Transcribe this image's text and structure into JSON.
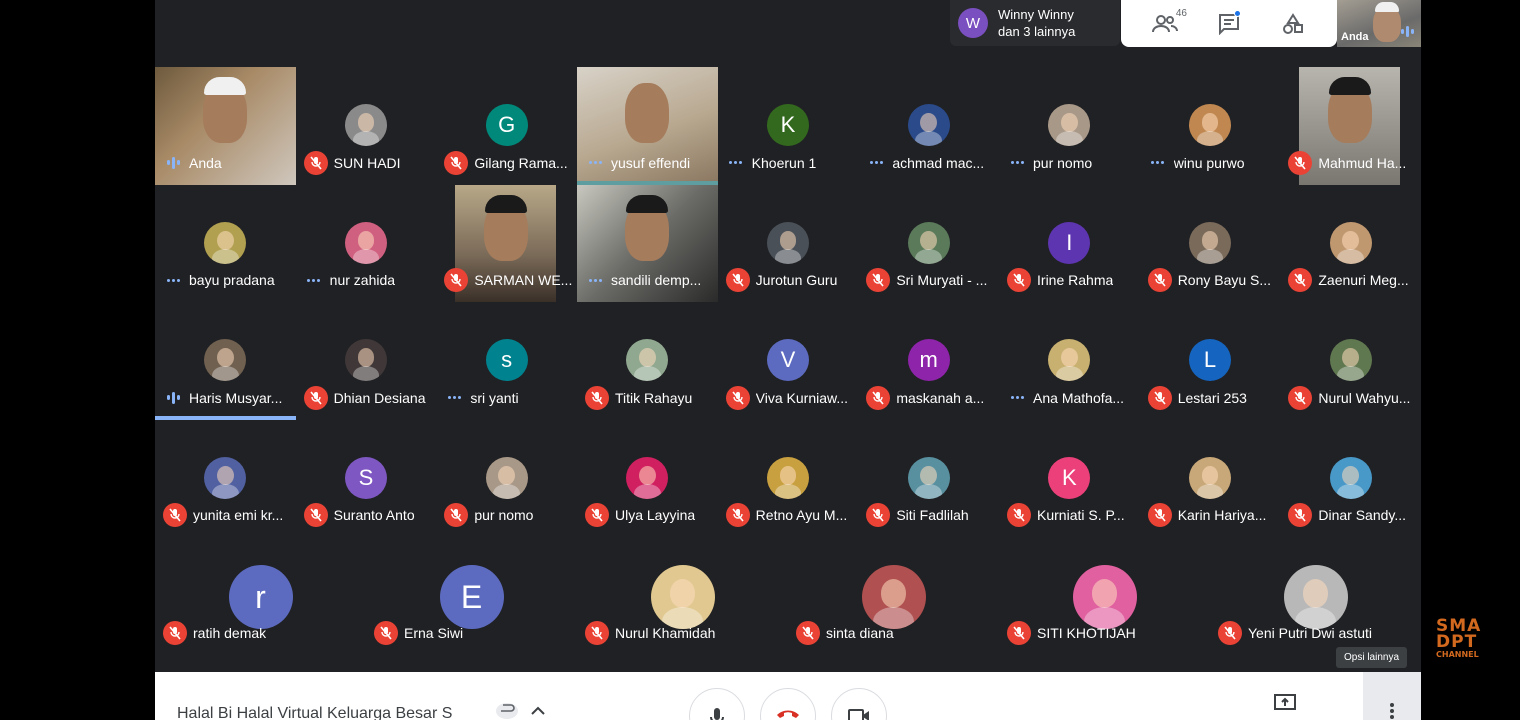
{
  "notification": {
    "avatar_letter": "W",
    "line1": "Winny Winny",
    "line2": "dan 3 lainnya"
  },
  "top_controls": {
    "participants_count": "46"
  },
  "self_view": {
    "label": "Anda"
  },
  "participants": [
    {
      "name": "Anda",
      "status": "speaking",
      "avatar": {
        "type": "video"
      }
    },
    {
      "name": "SUN HADI",
      "status": "muted",
      "avatar": {
        "type": "photo",
        "color": "#8a8a8a"
      }
    },
    {
      "name": "Gilang Rama...",
      "status": "muted",
      "avatar": {
        "type": "letter",
        "letter": "G",
        "color": "#00897b"
      }
    },
    {
      "name": "yusuf effendi",
      "status": "idle",
      "avatar": {
        "type": "video"
      }
    },
    {
      "name": "Khoerun 1",
      "status": "idle",
      "avatar": {
        "type": "letter",
        "letter": "K",
        "color": "#33691e"
      }
    },
    {
      "name": "achmad mac...",
      "status": "idle",
      "avatar": {
        "type": "photo",
        "color": "#2a4a8a"
      }
    },
    {
      "name": "pur nomo",
      "status": "idle",
      "avatar": {
        "type": "photo",
        "color": "#a89888"
      }
    },
    {
      "name": "winu purwo",
      "status": "idle",
      "avatar": {
        "type": "photo",
        "color": "#c08850"
      }
    },
    {
      "name": "Mahmud Ha...",
      "status": "muted",
      "avatar": {
        "type": "video"
      }
    },
    {
      "name": "bayu pradana",
      "status": "idle",
      "avatar": {
        "type": "photo",
        "color": "#b0a050"
      }
    },
    {
      "name": "nur zahida",
      "status": "idle",
      "avatar": {
        "type": "photo",
        "color": "#d06080"
      }
    },
    {
      "name": "SARMAN WE...",
      "status": "muted",
      "avatar": {
        "type": "video"
      }
    },
    {
      "name": "sandili demp...",
      "status": "idle",
      "avatar": {
        "type": "video"
      }
    },
    {
      "name": "Jurotun Guru",
      "status": "muted",
      "avatar": {
        "type": "photo",
        "color": "#4a5058"
      }
    },
    {
      "name": "Sri Muryati - ...",
      "status": "muted",
      "avatar": {
        "type": "photo",
        "color": "#5a7a5a"
      }
    },
    {
      "name": "Irine Rahma",
      "status": "muted",
      "avatar": {
        "type": "letter",
        "letter": "I",
        "color": "#5e35b1"
      }
    },
    {
      "name": "Rony Bayu S...",
      "status": "muted",
      "avatar": {
        "type": "photo",
        "color": "#7a6a5a"
      }
    },
    {
      "name": "Zaenuri Meg...",
      "status": "muted",
      "avatar": {
        "type": "photo",
        "color": "#c09870"
      }
    },
    {
      "name": "Haris Musyar...",
      "status": "speaking",
      "avatar": {
        "type": "photo",
        "color": "#706050"
      }
    },
    {
      "name": "Dhian Desiana",
      "status": "muted",
      "avatar": {
        "type": "photo",
        "color": "#403838"
      }
    },
    {
      "name": "sri yanti",
      "status": "idle",
      "avatar": {
        "type": "letter",
        "letter": "s",
        "color": "#00838f"
      }
    },
    {
      "name": "Titik Rahayu",
      "status": "muted",
      "avatar": {
        "type": "photo",
        "color": "#90a890"
      }
    },
    {
      "name": "Viva Kurniaw...",
      "status": "muted",
      "avatar": {
        "type": "letter",
        "letter": "V",
        "color": "#5c6bc0"
      }
    },
    {
      "name": "maskanah a...",
      "status": "muted",
      "avatar": {
        "type": "letter",
        "letter": "m",
        "color": "#8e24aa"
      }
    },
    {
      "name": "Ana Mathofa...",
      "status": "idle",
      "avatar": {
        "type": "photo",
        "color": "#c8b070"
      }
    },
    {
      "name": "Lestari 253",
      "status": "muted",
      "avatar": {
        "type": "letter",
        "letter": "L",
        "color": "#1565c0"
      }
    },
    {
      "name": "Nurul Wahyu...",
      "status": "muted",
      "avatar": {
        "type": "photo",
        "color": "#607850"
      }
    },
    {
      "name": "yunita emi kr...",
      "status": "muted",
      "avatar": {
        "type": "photo",
        "color": "#5060a0"
      }
    },
    {
      "name": "Suranto Anto",
      "status": "muted",
      "avatar": {
        "type": "letter",
        "letter": "S",
        "color": "#7e57c2"
      }
    },
    {
      "name": "pur nomo",
      "status": "muted",
      "avatar": {
        "type": "photo",
        "color": "#a89888"
      }
    },
    {
      "name": "Ulya Layyina",
      "status": "muted",
      "avatar": {
        "type": "photo",
        "color": "#d02060"
      }
    },
    {
      "name": "Retno Ayu M...",
      "status": "muted",
      "avatar": {
        "type": "photo",
        "color": "#c8a040"
      }
    },
    {
      "name": "Siti Fadlilah",
      "status": "muted",
      "avatar": {
        "type": "photo",
        "color": "#5890a0"
      }
    },
    {
      "name": "Kurniati S. P...",
      "status": "muted",
      "avatar": {
        "type": "letter",
        "letter": "K",
        "color": "#ec407a"
      }
    },
    {
      "name": "Karin Hariya...",
      "status": "muted",
      "avatar": {
        "type": "photo",
        "color": "#c8a878"
      }
    },
    {
      "name": "Dinar Sandy...",
      "status": "muted",
      "avatar": {
        "type": "photo",
        "color": "#4898c8"
      }
    },
    {
      "name": "ratih demak",
      "status": "muted",
      "avatar": {
        "type": "letter",
        "letter": "r",
        "color": "#5c6bc0"
      }
    },
    {
      "name": "Erna Siwi",
      "status": "muted",
      "avatar": {
        "type": "letter",
        "letter": "E",
        "color": "#5c6bc0"
      }
    },
    {
      "name": "Nurul Khamidah",
      "status": "muted",
      "avatar": {
        "type": "photo",
        "color": "#e0c890"
      }
    },
    {
      "name": "sinta diana",
      "status": "muted",
      "avatar": {
        "type": "photo",
        "color": "#b05050"
      }
    },
    {
      "name": "SITI KHOTIJAH",
      "status": "muted",
      "avatar": {
        "type": "photo",
        "color": "#e060a0"
      }
    },
    {
      "name": "Yeni Putri Dwi astuti",
      "status": "muted",
      "avatar": {
        "type": "photo",
        "color": "#b8b8b8"
      }
    }
  ],
  "tooltip": "Opsi lainnya",
  "bottom_bar": {
    "meeting_title": "Halal Bi Halal Virtual Keluarga Besar S"
  },
  "watermark": {
    "line1": "SMA",
    "line2": "DPT",
    "line3": "CHANNEL"
  },
  "colors": {
    "background": "#202124",
    "mute_red": "#ea4335",
    "speaking_blue": "#8ab4f8"
  }
}
